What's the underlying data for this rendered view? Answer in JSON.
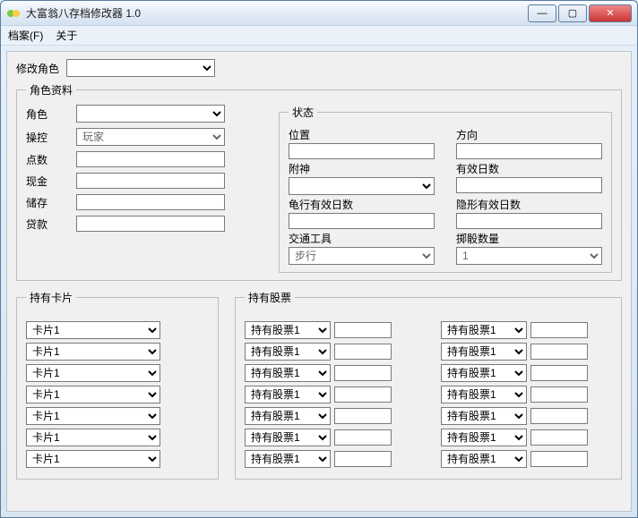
{
  "window": {
    "title": "大富翁八存档修改器 1.0",
    "min": "—",
    "max": "▢",
    "close": "✕"
  },
  "menu": {
    "file": "档案(F)",
    "about": "关于"
  },
  "topRow": {
    "modifyRoleLabel": "修改角色",
    "modifyRoleValue": ""
  },
  "roleInfo": {
    "legend": "角色资料",
    "fields": {
      "roleLabel": "角色",
      "roleValue": "",
      "controlLabel": "操控",
      "controlValue": "玩家",
      "pointsLabel": "点数",
      "pointsValue": "",
      "cashLabel": "现金",
      "cashValue": "",
      "savingsLabel": "储存",
      "savingsValue": "",
      "loanLabel": "贷款",
      "loanValue": ""
    }
  },
  "status": {
    "legend": "状态",
    "positionLabel": "位置",
    "positionValue": "",
    "directionLabel": "方向",
    "directionValue": "",
    "godLabel": "附神",
    "godValue": "",
    "validDaysLabel": "有效日数",
    "validDaysValue": "",
    "turtleDaysLabel": "龟行有效日数",
    "turtleDaysValue": "",
    "invisDaysLabel": "隐形有效日数",
    "invisDaysValue": "",
    "vehicleLabel": "交通工具",
    "vehicleValue": "步行",
    "diceLabel": "掷骰数量",
    "diceValue": "1"
  },
  "cards": {
    "legend": "持有卡片",
    "items": [
      "卡片1",
      "卡片1",
      "卡片1",
      "卡片1",
      "卡片1",
      "卡片1",
      "卡片1"
    ]
  },
  "stocks": {
    "legend": "持有股票",
    "left": [
      {
        "name": "持有股票1",
        "qty": ""
      },
      {
        "name": "持有股票1",
        "qty": ""
      },
      {
        "name": "持有股票1",
        "qty": ""
      },
      {
        "name": "持有股票1",
        "qty": ""
      },
      {
        "name": "持有股票1",
        "qty": ""
      },
      {
        "name": "持有股票1",
        "qty": ""
      },
      {
        "name": "持有股票1",
        "qty": ""
      }
    ],
    "right": [
      {
        "name": "持有股票1",
        "qty": ""
      },
      {
        "name": "持有股票1",
        "qty": ""
      },
      {
        "name": "持有股票1",
        "qty": ""
      },
      {
        "name": "持有股票1",
        "qty": ""
      },
      {
        "name": "持有股票1",
        "qty": ""
      },
      {
        "name": "持有股票1",
        "qty": ""
      },
      {
        "name": "持有股票1",
        "qty": ""
      }
    ]
  }
}
